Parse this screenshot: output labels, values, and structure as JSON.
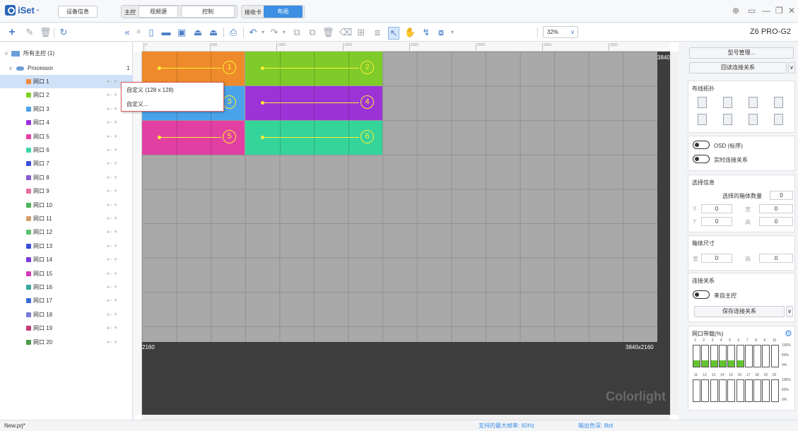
{
  "app": {
    "name": "iSet",
    "name_suffix": "-"
  },
  "topbar": {
    "device_info": "设备信息",
    "main_control": "主控",
    "video_source": "视频源",
    "control": "控制",
    "receive_card": "接收卡",
    "layout": "布局"
  },
  "toolbar": {
    "zoom": "32%",
    "model": "Z6 PRO-G2"
  },
  "tree": {
    "root_label": "所有主控 (1)",
    "processor_label": "Processor",
    "processor_count": "1",
    "ports": [
      {
        "label": "网口 1",
        "color": "#f08a3a"
      },
      {
        "label": "网口 2",
        "color": "#7ed321"
      },
      {
        "label": "网口 3",
        "color": "#4aa3ea"
      },
      {
        "label": "网口 4",
        "color": "#9b30d9"
      },
      {
        "label": "网口 5",
        "color": "#e63fa9"
      },
      {
        "label": "网口 6",
        "color": "#3dd6a8"
      },
      {
        "label": "网口 7",
        "color": "#3a4fd8"
      },
      {
        "label": "网口 8",
        "color": "#8a5cd0"
      },
      {
        "label": "网口 9",
        "color": "#e86fa0"
      },
      {
        "label": "网口 10",
        "color": "#4ab55a"
      },
      {
        "label": "网口 11",
        "color": "#d4a06a"
      },
      {
        "label": "网口 12",
        "color": "#5bc36f"
      },
      {
        "label": "网口 13",
        "color": "#3a4fd8"
      },
      {
        "label": "网口 14",
        "color": "#7a3ad8"
      },
      {
        "label": "网口 15",
        "color": "#d03ab8"
      },
      {
        "label": "网口 16",
        "color": "#3aa59a"
      },
      {
        "label": "网口 17",
        "color": "#3a6ad8"
      },
      {
        "label": "网口 18",
        "color": "#7a7ad8"
      },
      {
        "label": "网口 19",
        "color": "#c03a7a"
      },
      {
        "label": "网口 20",
        "color": "#4a9a4a"
      }
    ]
  },
  "context_menu": {
    "item1": "自定义 (128 x 128)",
    "item2": "自定义..."
  },
  "canvas": {
    "width_label": "3840",
    "height_label": "2160",
    "size_label": "3840x2160",
    "brand": "Colorlight",
    "ruler_marks": [
      "0",
      "500",
      "1000",
      "1500",
      "2000",
      "2500",
      "3000",
      "3500"
    ],
    "cabinets": [
      {
        "num": "1",
        "color": "#ee8a2b"
      },
      {
        "num": "2",
        "color": "#7ecb2a"
      },
      {
        "num": "3",
        "color": "#4aa3ea"
      },
      {
        "num": "4",
        "color": "#9c33d6"
      },
      {
        "num": "5",
        "color": "#e23fa2"
      },
      {
        "num": "6",
        "color": "#35d49a"
      }
    ]
  },
  "right_panel": {
    "model_manage": "型号管理...",
    "read_connection": "回读连接关系",
    "wiring_topology": "布线拓扑",
    "osd_label": "OSD (标序)",
    "realtime_connection": "实时连接关系",
    "selection_info": "选择信息",
    "selected_count_label": "选择的箱体数量",
    "selected_count": "0",
    "x_label": "X",
    "x_value": "0",
    "w_label": "宽",
    "w_value": "0",
    "y_label": "Y",
    "y_value": "0",
    "h_label": "高",
    "h_value": "0",
    "cabinet_size": "箱体尺寸",
    "size_w_label": "宽",
    "size_w": "0",
    "size_h_label": "高",
    "size_h": "0",
    "connection": "连接关系",
    "from_main": "来自主控",
    "save_connection": "保存连接关系",
    "port_bandwidth": "网口带载(%)",
    "bw_row1_labels": [
      "1",
      "2",
      "3",
      "4",
      "5",
      "6",
      "7",
      "8",
      "9",
      "10"
    ],
    "bw_row2_labels": [
      "11",
      "12",
      "13",
      "14",
      "15",
      "16",
      "17",
      "18",
      "19",
      "20"
    ],
    "bw_row1_values": [
      30,
      30,
      30,
      30,
      30,
      30,
      0,
      0,
      0,
      0
    ],
    "bw_row2_values": [
      0,
      0,
      0,
      0,
      0,
      0,
      0,
      0,
      0,
      0
    ],
    "scale": [
      "100%",
      "50%",
      "0%"
    ]
  },
  "status": {
    "project": "New.prj*",
    "max_refresh": "支持的最大帧率: 60Hz",
    "output_depth": "输出色深: 8bit"
  }
}
